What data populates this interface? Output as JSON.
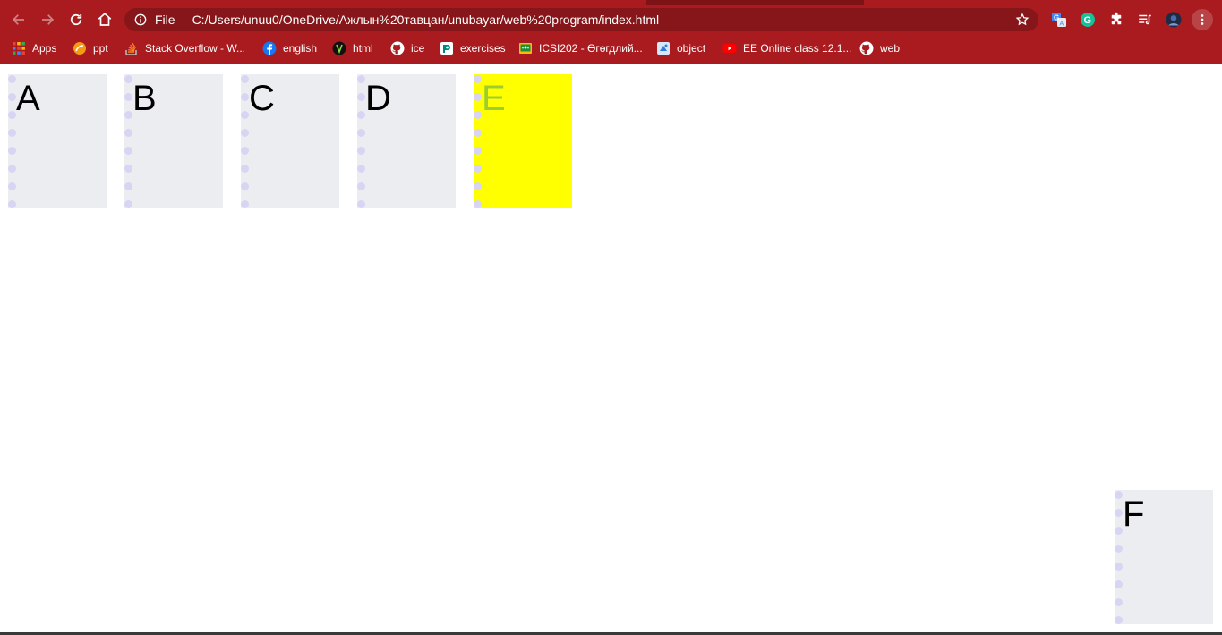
{
  "browser": {
    "omnibox": {
      "scheme_label": "File",
      "url": "C:/Users/unuu0/OneDrive/Ажлын%20тавцан/unubayar/web%20program/index.html"
    },
    "nav_icons": [
      "back-arrow-icon",
      "forward-arrow-icon",
      "reload-icon",
      "home-icon"
    ],
    "extension_icons": [
      "google-translate-icon",
      "grammarly-icon",
      "extensions-puzzle-icon",
      "reading-list-icon",
      "profile-avatar",
      "menu-dots-icon"
    ],
    "bookmarks": [
      {
        "label": "Apps",
        "icon": "apps-grid-icon"
      },
      {
        "label": "ppt",
        "icon": "ppt-icon"
      },
      {
        "label": "Stack Overflow - W...",
        "icon": "stackoverflow-icon"
      },
      {
        "label": "english",
        "icon": "facebook-icon"
      },
      {
        "label": "html",
        "icon": "html-logo-icon"
      },
      {
        "label": "ice",
        "icon": "github-icon"
      },
      {
        "label": "exercises",
        "icon": "exercises-icon"
      },
      {
        "label": "ICSI202 - Өгөгдлий...",
        "icon": "google-classroom-icon"
      },
      {
        "label": "object",
        "icon": "object-icon"
      },
      {
        "label": "EE Online class 12.1...",
        "icon": "youtube-icon"
      },
      {
        "label": "web",
        "icon": "github-icon"
      }
    ]
  },
  "colors": {
    "chrome_bg": "#a91b1f",
    "omnibox_bg": "#861619",
    "card_bg": "#ecedf1",
    "card_dots": "#d7d5f3",
    "highlight_bg": "#ffff00",
    "highlight_text": "#9ccf2d"
  },
  "cards": [
    {
      "letter": "A",
      "highlighted": false
    },
    {
      "letter": "B",
      "highlighted": false
    },
    {
      "letter": "C",
      "highlighted": false
    },
    {
      "letter": "D",
      "highlighted": false
    },
    {
      "letter": "E",
      "highlighted": true
    },
    {
      "letter": "F",
      "highlighted": false
    }
  ]
}
